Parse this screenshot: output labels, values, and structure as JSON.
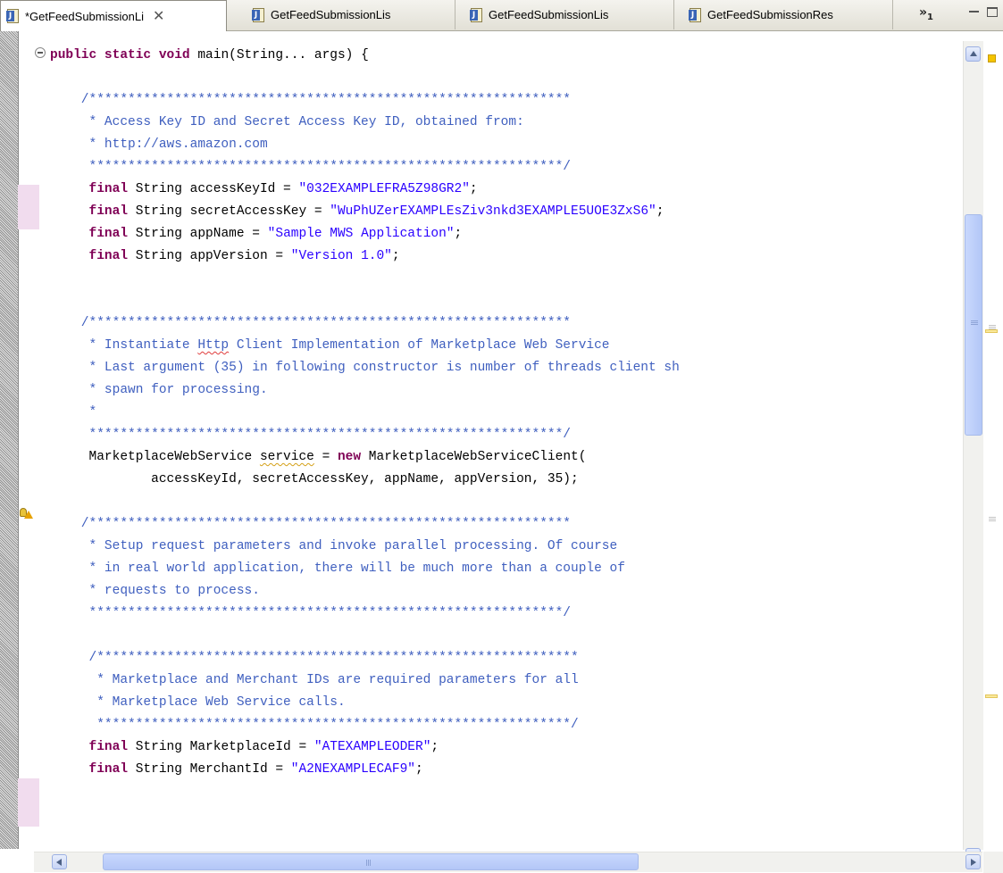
{
  "tabs": [
    {
      "label": "*GetFeedSubmissionLi",
      "close": "✕",
      "active": true
    },
    {
      "label": "GetFeedSubmissionLis",
      "active": false
    },
    {
      "label": "GetFeedSubmissionLis",
      "active": false
    },
    {
      "label": "GetFeedSubmissionRes",
      "active": false
    }
  ],
  "tab_icon_letter": "J",
  "overflow": {
    "symbol": "»",
    "count": "1"
  },
  "code_lines": [
    [
      {
        "t": "public static void",
        "c": "kw"
      },
      {
        "t": " main(String... args) {"
      }
    ],
    [],
    [
      {
        "t": "    /**************************************************************",
        "c": "cm"
      }
    ],
    [
      {
        "t": "     * Access Key ID and Secret Access Key ID, obtained from:",
        "c": "cm"
      }
    ],
    [
      {
        "t": "     * http://aws.amazon.com",
        "c": "cm"
      }
    ],
    [
      {
        "t": "     *************************************************************/",
        "c": "cm"
      }
    ],
    [
      {
        "t": "     "
      },
      {
        "t": "final",
        "c": "kw"
      },
      {
        "t": " String accessKeyId = "
      },
      {
        "t": "\"032EXAMPLEFRA5Z98GR2\"",
        "c": "str"
      },
      {
        "t": ";"
      }
    ],
    [
      {
        "t": "     "
      },
      {
        "t": "final",
        "c": "kw"
      },
      {
        "t": " String secretAccessKey = "
      },
      {
        "t": "\"WuPhUZerEXAMPLEsZiv3nkd3EXAMPLE5UOE3ZxS6\"",
        "c": "str"
      },
      {
        "t": ";"
      }
    ],
    [
      {
        "t": "     "
      },
      {
        "t": "final",
        "c": "kw"
      },
      {
        "t": " String appName = "
      },
      {
        "t": "\"Sample MWS Application\"",
        "c": "str"
      },
      {
        "t": ";"
      }
    ],
    [
      {
        "t": "     "
      },
      {
        "t": "final",
        "c": "kw"
      },
      {
        "t": " String appVersion = "
      },
      {
        "t": "\"Version 1.0\"",
        "c": "str"
      },
      {
        "t": ";"
      }
    ],
    [],
    [],
    [
      {
        "t": "    /**************************************************************",
        "c": "cm"
      }
    ],
    [
      {
        "t": "     * Instantiate ",
        "c": "cm"
      },
      {
        "t": "Http",
        "c": "cm spell"
      },
      {
        "t": " Client Implementation of Marketplace Web Service",
        "c": "cm"
      }
    ],
    [
      {
        "t": "     * Last argument (35) in following constructor is number of threads client sh",
        "c": "cm"
      }
    ],
    [
      {
        "t": "     * spawn for processing.",
        "c": "cm"
      }
    ],
    [
      {
        "t": "     *",
        "c": "cm"
      }
    ],
    [
      {
        "t": "     *************************************************************/",
        "c": "cm"
      }
    ],
    [
      {
        "t": "     MarketplaceWebService "
      },
      {
        "t": "service",
        "c": "warnunder"
      },
      {
        "t": " = "
      },
      {
        "t": "new",
        "c": "kw"
      },
      {
        "t": " MarketplaceWebServiceClient("
      }
    ],
    [
      {
        "t": "             accessKeyId, secretAccessKey, appName, appVersion, 35);"
      }
    ],
    [],
    [
      {
        "t": "    /**************************************************************",
        "c": "cm"
      }
    ],
    [
      {
        "t": "     * Setup request parameters and invoke parallel processing. Of course",
        "c": "cm"
      }
    ],
    [
      {
        "t": "     * in real world application, there will be much more than a couple of",
        "c": "cm"
      }
    ],
    [
      {
        "t": "     * requests to process.",
        "c": "cm"
      }
    ],
    [
      {
        "t": "     *************************************************************/",
        "c": "cm"
      }
    ],
    [],
    [
      {
        "t": "     /**************************************************************",
        "c": "cm"
      }
    ],
    [
      {
        "t": "      * Marketplace and Merchant IDs are required parameters for all",
        "c": "cm"
      }
    ],
    [
      {
        "t": "      * Marketplace Web Service calls.",
        "c": "cm"
      }
    ],
    [
      {
        "t": "      *************************************************************/",
        "c": "cm"
      }
    ],
    [
      {
        "t": "     "
      },
      {
        "t": "final",
        "c": "kw"
      },
      {
        "t": " String MarketplaceId = "
      },
      {
        "t": "\"ATEXAMPLEODER\"",
        "c": "str"
      },
      {
        "t": ";"
      }
    ],
    [
      {
        "t": "     "
      },
      {
        "t": "final",
        "c": "kw"
      },
      {
        "t": " String MerchantId = "
      },
      {
        "t": "\"A2NEXAMPLECAF9\"",
        "c": "str"
      },
      {
        "t": ";"
      }
    ]
  ],
  "colors": {
    "keyword": "#7f0055",
    "comment": "#3f5fbf",
    "string": "#2a00ff",
    "change_mark": "#f1dcee",
    "scroll_thumb": "#b3c7f7"
  }
}
